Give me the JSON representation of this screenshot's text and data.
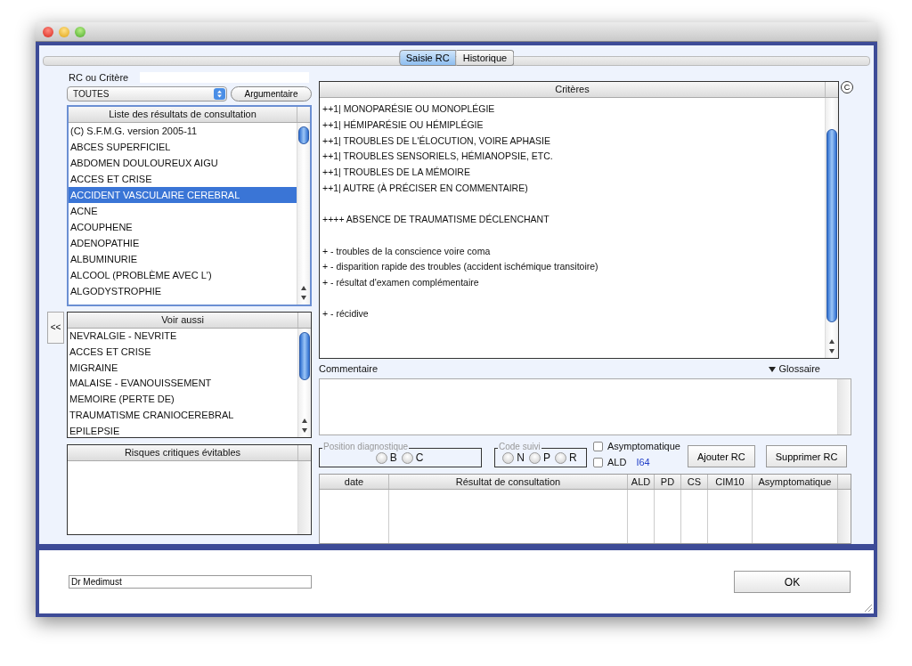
{
  "tabs": [
    {
      "label": "Saisie RC",
      "selected": true
    },
    {
      "label": "Historique",
      "selected": false
    }
  ],
  "rc_filter": {
    "label": "RC ou Critère",
    "popup_value": "TOUTES",
    "argumentaire_button": "Argumentaire"
  },
  "results_list": {
    "title": "Liste des résultats de consultation",
    "items": [
      {
        "label": "(C)  S.F.M.G. version 2005-11",
        "selected": false
      },
      {
        "label": "ABCES SUPERFICIEL",
        "selected": false
      },
      {
        "label": "ABDOMEN DOULOUREUX AIGU",
        "selected": false
      },
      {
        "label": "ACCES ET CRISE",
        "selected": false
      },
      {
        "label": "ACCIDENT VASCULAIRE CEREBRAL",
        "selected": true
      },
      {
        "label": "ACNE",
        "selected": false
      },
      {
        "label": "ACOUPHENE",
        "selected": false
      },
      {
        "label": "ADENOPATHIE",
        "selected": false
      },
      {
        "label": "ALBUMINURIE",
        "selected": false
      },
      {
        "label": "ALCOOL (PROBLÈME AVEC L')",
        "selected": false
      },
      {
        "label": "ALGODYSTROPHIE",
        "selected": false
      }
    ]
  },
  "back_button": "<<",
  "see_also": {
    "title": "Voir aussi",
    "items": [
      "NEVRALGIE - NEVRITE",
      "ACCES ET CRISE",
      "MIGRAINE",
      "MALAISE - EVANOUISSEMENT",
      "MEMOIRE (PERTE DE)",
      "TRAUMATISME CRANIOCEREBRAL",
      "EPILEPSIE"
    ]
  },
  "risks": {
    "title": "Risques critiques évitables"
  },
  "criteria": {
    "title": "Critères",
    "groups": [
      [
        "++1| MONOPARÉSIE OU MONOPLÉGIE",
        "++1| HÉMIPARÉSIE OU HÉMIPLÉGIE",
        "++1| TROUBLES DE L'ÉLOCUTION, VOIRE APHASIE",
        "++1| TROUBLES SENSORIELS, HÉMIANOPSIE, ETC.",
        "++1| TROUBLES DE LA MÉMOIRE",
        "++1| AUTRE (À PRÉCISER EN COMMENTAIRE)"
      ],
      [
        "++++ ABSENCE DE TRAUMATISME DÉCLENCHANT"
      ],
      [
        "+ - troubles de la conscience voire coma",
        "+ - disparition rapide des troubles (accident ischémique transitoire)",
        "+ - résultat d'examen complémentaire"
      ],
      [
        "+ - récidive"
      ]
    ]
  },
  "copyright_button": "C",
  "comment": {
    "label": "Commentaire",
    "glossary": "Glossaire"
  },
  "position_diagnostique": {
    "legend": "Position diagnostique",
    "options": [
      {
        "label": "B",
        "selected": false
      },
      {
        "label": "C",
        "selected": false
      }
    ]
  },
  "code_suivi": {
    "legend": "Code suivi",
    "options": [
      {
        "label": "N",
        "selected": false
      },
      {
        "label": "P",
        "selected": false
      },
      {
        "label": "R",
        "selected": false
      }
    ]
  },
  "asymptomatique": {
    "label": "Asymptomatique",
    "checked": false
  },
  "ald": {
    "label": "ALD",
    "checked": false,
    "code": "I64"
  },
  "buttons": [
    "Ajouter RC",
    "Supprimer RC"
  ],
  "history_table": {
    "columns": [
      "date",
      "Résultat de consultation",
      "ALD",
      "PD",
      "CS",
      "CIM10",
      "Asymptomatique"
    ]
  },
  "doctor_field": {
    "value": "Dr Medimust"
  },
  "ok_button": "OK"
}
